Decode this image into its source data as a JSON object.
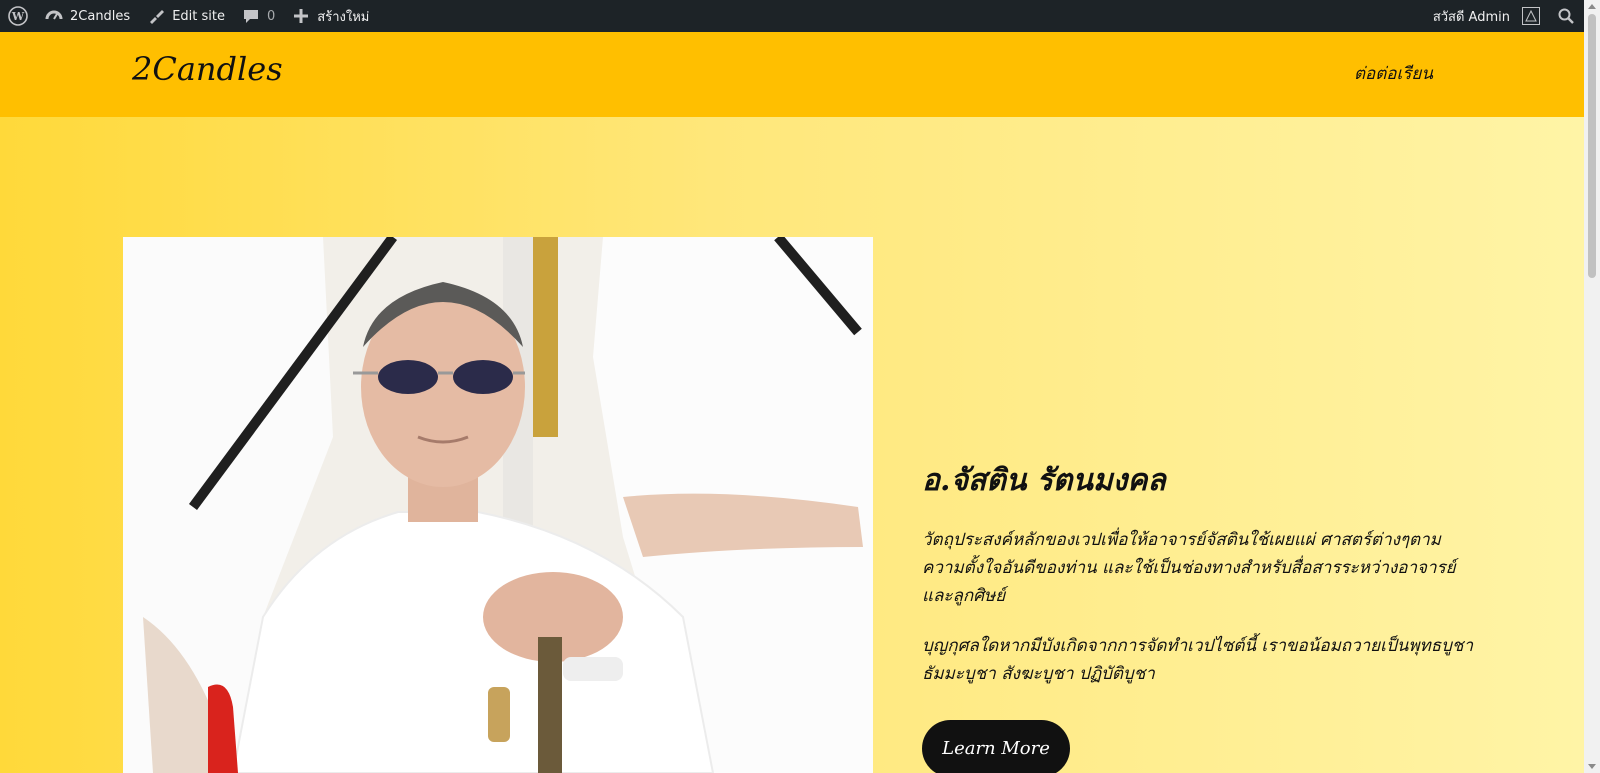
{
  "admin_bar": {
    "site_name": "2Candles",
    "edit_site": "Edit site",
    "comments_count": "0",
    "new_label": "สร้างใหม่",
    "greeting": "สวัสดี Admin"
  },
  "header": {
    "site_title": "2Candles",
    "nav_link": "ต่อต่อเรียน"
  },
  "hero": {
    "title": "อ.จัสติน รัตนมงคล",
    "paragraph1": "วัตถุประสงค์หลักของเวปเพื่อให้อาจารย์จัสตินใช้เผยแผ่ ศาสตร์ต่างๆตามความตั้งใจอันดีของท่าน และใช้เป็นช่องทางสำหรับสื่อสารระหว่างอาจารย์และลูกศิษย์",
    "paragraph2": "บุญกุศลใดหากมีบังเกิดจากการจัดทำเวปไซต์นี้ เราขอน้อมถวายเป็นพุทธบูชา ธัมมะบูชา สังฆะบูชา ปฏิบัติบูชา",
    "button_label": "Learn More"
  },
  "colors": {
    "admin_bar": "#1d2327",
    "header": "#ffbf00",
    "hero_gradient_start": "#ffd93a",
    "hero_gradient_end": "#fff4a6",
    "button": "#111111"
  },
  "icons": {
    "wordpress": "wordpress-logo-icon",
    "dashboard": "dashboard-icon",
    "edit": "brush-icon",
    "comments": "comment-bubble-icon",
    "new": "plus-icon",
    "search": "search-icon"
  }
}
